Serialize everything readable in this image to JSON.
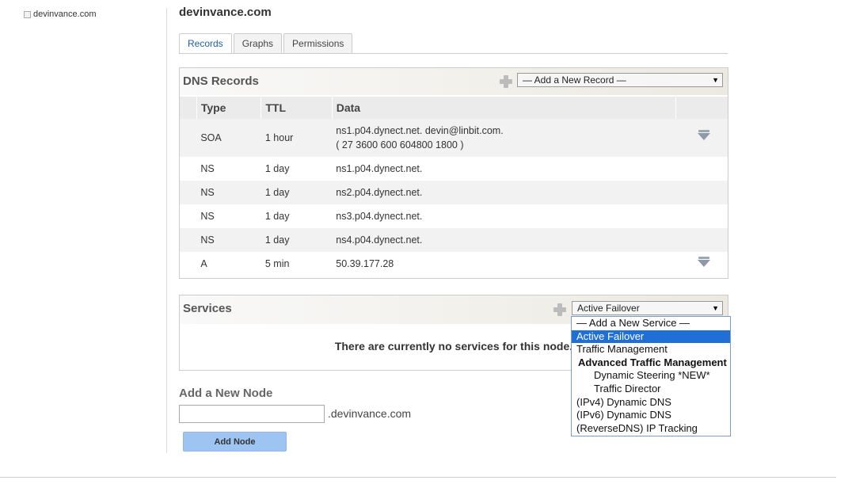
{
  "sidebar": {
    "zone": "devinvance.com"
  },
  "node": {
    "title": "devinvance.com"
  },
  "tabs": [
    {
      "label": "Records"
    },
    {
      "label": "Graphs"
    },
    {
      "label": "Permissions"
    }
  ],
  "dns": {
    "title": "DNS Records",
    "add_record_select": "— Add a New Record —",
    "columns": [
      "Type",
      "TTL",
      "Data"
    ],
    "rows": [
      {
        "type": "SOA",
        "ttl": "1 hour",
        "data": "ns1.p04.dynect.net. devin@linbit.com.",
        "data2": "( 27 3600 600 604800 1800 )"
      },
      {
        "type": "NS",
        "ttl": "1 day",
        "data": "ns1.p04.dynect.net."
      },
      {
        "type": "NS",
        "ttl": "1 day",
        "data": "ns2.p04.dynect.net."
      },
      {
        "type": "NS",
        "ttl": "1 day",
        "data": "ns3.p04.dynect.net."
      },
      {
        "type": "NS",
        "ttl": "1 day",
        "data": "ns4.p04.dynect.net."
      },
      {
        "type": "A",
        "ttl": "5 min",
        "data": "50.39.177.28"
      }
    ]
  },
  "services": {
    "title": "Services",
    "selected": "Active Failover",
    "empty_message": "There are currently no services for this node.",
    "options": [
      {
        "label": "— Add a New Service —"
      },
      {
        "label": "Active Failover"
      },
      {
        "label": "Traffic Management"
      },
      {
        "label": "Advanced Traffic Management"
      },
      {
        "label": "Dynamic Steering *NEW*"
      },
      {
        "label": "Traffic Director"
      },
      {
        "label": "(IPv4) Dynamic DNS"
      },
      {
        "label": "(IPv6) Dynamic DNS"
      },
      {
        "label": "(ReverseDNS) IP Tracking"
      }
    ]
  },
  "add_node": {
    "title": "Add a New Node",
    "input_value": "",
    "suffix": ".devinvance.com",
    "button": "Add Node"
  },
  "colors": {
    "link": "#1f5fa8",
    "selected_option": "#1f6fd6",
    "button": "#9ec4f2"
  }
}
